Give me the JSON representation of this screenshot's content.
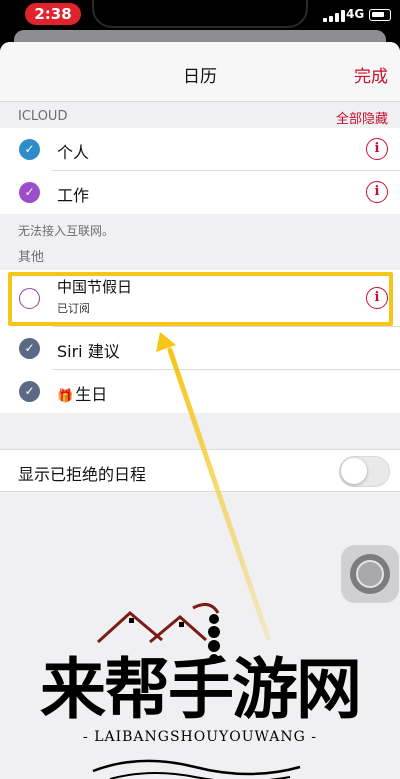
{
  "status": {
    "time": "2:38",
    "network": "4G"
  },
  "nav": {
    "title": "日历",
    "done_label": "完成"
  },
  "icloud": {
    "header": "ICLOUD",
    "hide_all_label": "全部隐藏",
    "calendars": [
      {
        "label": "个人",
        "checked": true,
        "color": "#2e8dc9"
      },
      {
        "label": "工作",
        "checked": true,
        "color": "#9b4dca"
      }
    ],
    "note": "无法接入互联网。"
  },
  "other": {
    "header": "其他",
    "holiday": {
      "label": "中国节假日",
      "subtitle": "已订阅",
      "checked": false
    },
    "siri": {
      "label": "Siri 建议",
      "checked": true,
      "color": "#5a6a85"
    },
    "birthday": {
      "label": "生日",
      "checked": true,
      "color": "#5a6a85",
      "icon": "gift-icon"
    }
  },
  "declined": {
    "label": "显示已拒绝的日程",
    "enabled": false
  },
  "watermark": {
    "title": "来帮手游网",
    "subtitle": "- LAIBANGSHOUYOUWANG -"
  },
  "colors": {
    "accent": "#c8102e",
    "highlight": "#f5c518"
  }
}
